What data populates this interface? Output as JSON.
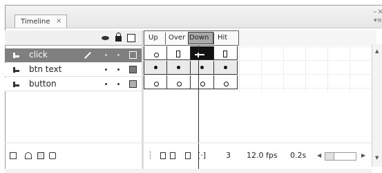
{
  "tab": {
    "label": "Timeline",
    "close": "×"
  },
  "window_controls": {
    "minimize": "–",
    "close": "×",
    "menu": "▾≡"
  },
  "header": {
    "eye_icon": "eye-icon",
    "lock_icon": "lock-icon",
    "outline_icon": "outline-icon",
    "frames": [
      "Up",
      "Over",
      "Down",
      "Hit"
    ]
  },
  "layers": [
    {
      "name": "click",
      "selected": true,
      "color": "#ffffff"
    },
    {
      "name": "btn text",
      "selected": false,
      "color": "#7a7a7a"
    },
    {
      "name": "button",
      "selected": false,
      "color": "#b0b0b0"
    }
  ],
  "status": {
    "current_frame": "3",
    "fps": "12.0 fps",
    "time": "0.2s"
  },
  "colors": {
    "selected_layer_bg": "#7f7f7f",
    "playhead": "#111111",
    "grid_line": "#303030"
  }
}
